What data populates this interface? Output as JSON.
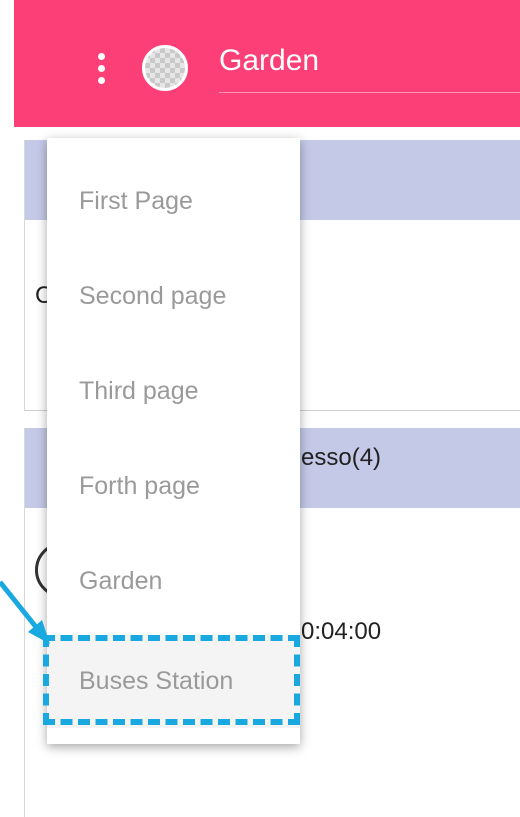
{
  "appbar": {
    "title": "Garden",
    "background_color": "#fd3f77",
    "menu_icon": "more-vert-icon",
    "logo_icon": "checker-avatar-icon"
  },
  "content": {
    "card1_text": "C",
    "card2_title": "esso(4)",
    "time": "0:04:00"
  },
  "dropdown": {
    "items": [
      {
        "label": "First Page"
      },
      {
        "label": "Second page"
      },
      {
        "label": "Third page"
      },
      {
        "label": "Forth page"
      },
      {
        "label": "Garden"
      },
      {
        "label": "Buses Station"
      }
    ],
    "highlight_color": "#1aa8e0"
  }
}
